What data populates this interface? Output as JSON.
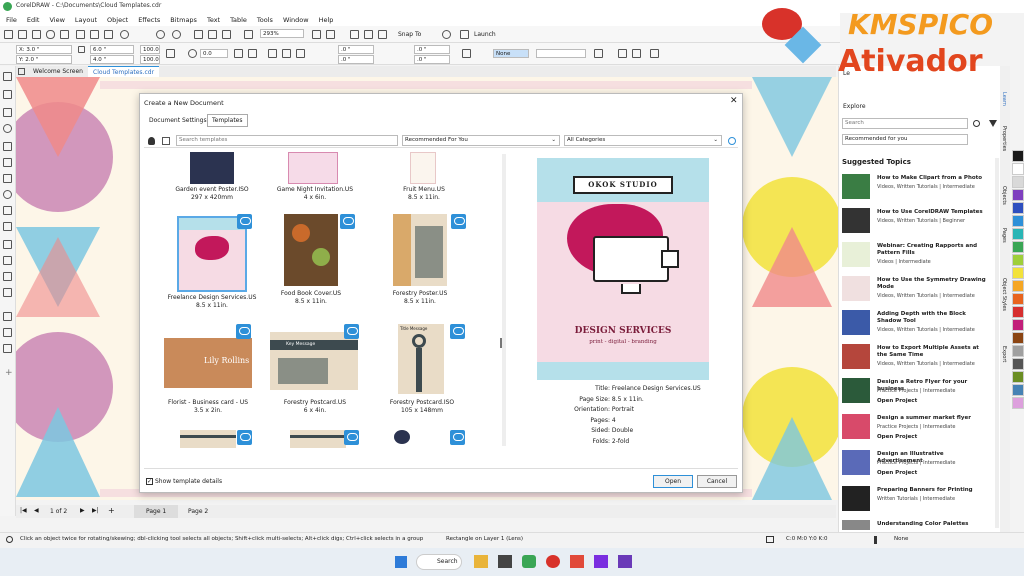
{
  "app": {
    "title": "CorelDRAW - C:\\Documents\\Cloud Templates.cdr"
  },
  "menu": [
    "File",
    "Edit",
    "View",
    "Layout",
    "Object",
    "Effects",
    "Bitmaps",
    "Text",
    "Table",
    "Tools",
    "Window",
    "Help"
  ],
  "toolbar": {
    "zoom": "293%",
    "snap": "Snap To",
    "launch": "Launch",
    "x": "X: 3.0 \"",
    "y": "Y: 2.0 \"",
    "w": "6.0 \"",
    "h": "4.0 \"",
    "sx": "100.0",
    "sy": "100.0",
    "rot": "0.0",
    "o1": ".0 \"",
    "o2": ".0 \"",
    "o3": ".0 \"",
    "o4": ".0 \"",
    "fill": "None"
  },
  "doc_tabs": [
    "Welcome Screen",
    "Cloud Templates.cdr"
  ],
  "dialog": {
    "title": "Create a New Document",
    "tabs": [
      "Document Settings",
      "Templates"
    ],
    "search_placeholder": "Search templates",
    "filter1": "Recommended For You",
    "filter2": "All Categories",
    "templates": [
      {
        "name": "Garden event Poster.ISO",
        "size": "297 x 420mm"
      },
      {
        "name": "Game Night Invitation.US",
        "size": "4 x 6in."
      },
      {
        "name": "Fruit Menu.US",
        "size": "8.5 x 11in."
      },
      {
        "name": "Freelance Design Services.US",
        "size": "8.5 x 11in."
      },
      {
        "name": "Food Book Cover.US",
        "size": "8.5 x 11in."
      },
      {
        "name": "Forestry Poster.US",
        "size": "8.5 x 11in."
      },
      {
        "name": "Florist - Business card - US",
        "size": "3.5 x 2in."
      },
      {
        "name": "Forestry Postcard.US",
        "size": "6 x 4in."
      },
      {
        "name": "Forestry Postcard.ISO",
        "size": "105 x 148mm"
      }
    ],
    "thumb_texts": {
      "lily": "Lily Rollins",
      "key": "Key Message",
      "title_key": "Title Message"
    },
    "preview": {
      "studio": "OKOK STUDIO",
      "headline": "DESIGN SERVICES",
      "tagline": "print - digital - branding"
    },
    "details": [
      {
        "k": "Title:",
        "v": "Freelance Design Services.US"
      },
      {
        "k": "Page Size:",
        "v": "8.5 x 11in."
      },
      {
        "k": "Orientation:",
        "v": "Portrait"
      },
      {
        "k": "Pages:",
        "v": "4"
      },
      {
        "k": "Sided:",
        "v": "Double"
      },
      {
        "k": "Folds:",
        "v": "2-fold"
      }
    ],
    "show_details": "Show template details",
    "open": "Open",
    "cancel": "Cancel"
  },
  "panel": {
    "learn": "Le",
    "explore": "Explore",
    "search_placeholder": "Search",
    "recommended": "Recommended for you",
    "suggested": "Suggested Topics",
    "topics": [
      {
        "t": "How to Make Clipart from a Photo",
        "m": "Videos, Written Tutorials | Intermediate"
      },
      {
        "t": "How to Use CorelDRAW Templates",
        "m": "Videos, Written Tutorials | Beginner"
      },
      {
        "t": "Webinar: Creating Rapports and Pattern Fills",
        "m": "Videos | Intermediate"
      },
      {
        "t": "How to Use the Symmetry Drawing Mode",
        "m": "Videos, Written Tutorials | Intermediate"
      },
      {
        "t": "Adding Depth with the Block Shadow Tool",
        "m": "Videos, Written Tutorials | Intermediate"
      },
      {
        "t": "How to Export Multiple Assets at the Same Time",
        "m": "Videos, Written Tutorials | Intermediate"
      },
      {
        "t": "Design a Retro Flyer for your business",
        "m": "Practice Projects | Intermediate",
        "x": "Open Project"
      },
      {
        "t": "Design a summer market flyer",
        "m": "Practice Projects | Intermediate",
        "x": "Open Project"
      },
      {
        "t": "Design an Illustrative Advertisement",
        "m": "Practice Projects | Intermediate",
        "x": "Open Project"
      },
      {
        "t": "Preparing Banners for Printing",
        "m": "Written Tutorials | Intermediate"
      },
      {
        "t": "Understanding Color Palettes",
        "m": ""
      }
    ]
  },
  "side_tabs": [
    "Learn",
    "Properties",
    "Objects",
    "Pages",
    "Object Styles",
    "Export"
  ],
  "pages": {
    "nav": "1 of 2",
    "page1": "Page 1",
    "page2": "Page 2"
  },
  "status": {
    "hint": "Click an object twice for rotating/skewing; dbl-clicking tool selects all objects; Shift+click multi-selects; Alt+click digs; Ctrl+click selects in a group",
    "layer": "Rectangle on Layer 1 (Lens)",
    "cmyk": "C:0 M:0 Y:0 K:0",
    "fill": "None"
  },
  "watermark": {
    "line1": "KMSPICO",
    "line2": "Ativador"
  },
  "taskbar": {
    "search": "Search"
  },
  "palette": [
    "#1a1a1a",
    "#ffffff",
    "#d9d9d9",
    "#7f3fbf",
    "#2e4fbf",
    "#2e90d8",
    "#29b5b5",
    "#3aa655",
    "#9fcf3a",
    "#f2e23a",
    "#f5a623",
    "#e8641e",
    "#d62f2f",
    "#c21f7a",
    "#8b4513",
    "#a0a0a0",
    "#555555",
    "#6b8e23",
    "#4682b4",
    "#dda0dd"
  ]
}
